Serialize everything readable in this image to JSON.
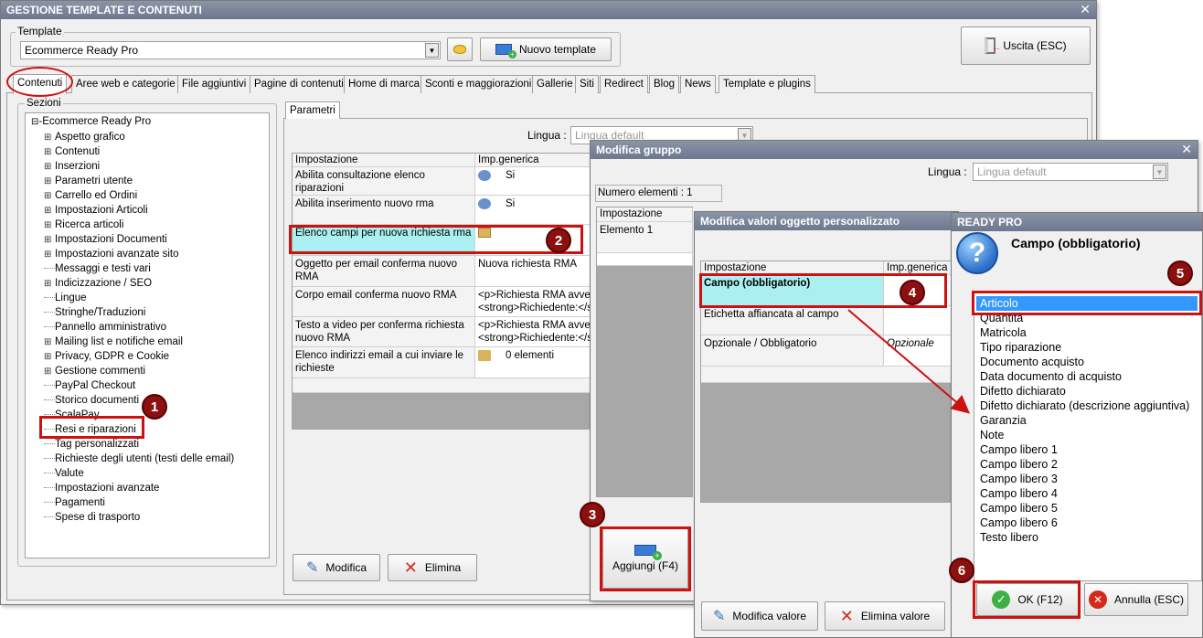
{
  "main_window": {
    "title": "GESTIONE TEMPLATE E CONTENUTI",
    "template_label": "Template",
    "template_value": "Ecommerce Ready Pro",
    "new_template_button": "Nuovo template",
    "exit_button": "Uscita (ESC)"
  },
  "tabs": [
    {
      "label": "Contenuti"
    },
    {
      "label": "Aree web e categorie"
    },
    {
      "label": "File aggiuntivi"
    },
    {
      "label": "Pagine di contenuti"
    },
    {
      "label": "Home di marca"
    },
    {
      "label": "Sconti e maggiorazioni"
    },
    {
      "label": "Gallerie"
    },
    {
      "label": "Siti"
    },
    {
      "label": "Redirect"
    },
    {
      "label": "Blog"
    },
    {
      "label": "News"
    },
    {
      "label": "Template e plugins"
    }
  ],
  "sections": {
    "label": "Sezioni",
    "root": "Ecommerce Ready Pro",
    "items": [
      {
        "label": "Aspetto grafico",
        "expandable": true
      },
      {
        "label": "Contenuti",
        "expandable": true
      },
      {
        "label": "Inserzioni",
        "expandable": true
      },
      {
        "label": "Parametri utente",
        "expandable": true
      },
      {
        "label": "Carrello ed Ordini",
        "expandable": true
      },
      {
        "label": "Impostazioni Articoli",
        "expandable": true
      },
      {
        "label": "Ricerca articoli",
        "expandable": true
      },
      {
        "label": "Impostazioni Documenti",
        "expandable": true
      },
      {
        "label": "Impostazioni avanzate sito",
        "expandable": true
      },
      {
        "label": "Messaggi e testi vari",
        "expandable": false
      },
      {
        "label": "Indicizzazione / SEO",
        "expandable": true
      },
      {
        "label": "Lingue",
        "expandable": false
      },
      {
        "label": "Stringhe/Traduzioni",
        "expandable": false
      },
      {
        "label": "Pannello amministrativo",
        "expandable": false
      },
      {
        "label": "Mailing list e notifiche email",
        "expandable": true
      },
      {
        "label": "Privacy, GDPR e Cookie",
        "expandable": true
      },
      {
        "label": "Gestione commenti",
        "expandable": true
      },
      {
        "label": "PayPal Checkout",
        "expandable": false
      },
      {
        "label": "Storico documenti",
        "expandable": false
      },
      {
        "label": "ScalaPay",
        "expandable": false
      },
      {
        "label": "Resi e riparazioni",
        "expandable": false
      },
      {
        "label": "Tag personalizzati",
        "expandable": false
      },
      {
        "label": "Richieste degli utenti (testi delle email)",
        "expandable": false
      },
      {
        "label": "Valute",
        "expandable": false
      },
      {
        "label": "Impostazioni avanzate",
        "expandable": false
      },
      {
        "label": "Pagamenti",
        "expandable": false
      },
      {
        "label": "Spese di trasporto",
        "expandable": false
      }
    ]
  },
  "params": {
    "tab": "Parametri",
    "language_label": "Lingua :",
    "language_value": "Lingua default",
    "col_setting": "Impostazione",
    "col_value": "Imp.generica",
    "rows": [
      {
        "setting": "Abilita consultazione elenco riparazioni",
        "value": "Si"
      },
      {
        "setting": "Abilita inserimento nuovo rma",
        "value": "Si"
      },
      {
        "setting": "Elenco campi per nuova richiesta rma",
        "value": ""
      },
      {
        "setting": "Oggetto per email conferma nuovo RMA",
        "value": "Nuova richiesta RMA"
      },
      {
        "setting": "Corpo email conferma nuovo RMA",
        "value": "<p>Richiesta RMA avven\n<strong>Richiedente:</s"
      },
      {
        "setting": "Testo a video per conferma richiesta nuovo RMA",
        "value": "<p>Richiesta RMA avven\n<strong>Richiedente:</s"
      },
      {
        "setting": "Elenco indirizzi email a cui inviare le richieste",
        "value": "0 elementi"
      }
    ],
    "edit_button": "Modifica",
    "delete_button": "Elimina"
  },
  "group_dialog": {
    "title": "Modifica gruppo",
    "language_label": "Lingua :",
    "language_value": "Lingua default",
    "count_label": "Numero elementi : 1",
    "col_setting": "Impostazione",
    "element": "Elemento 1",
    "add_button": "Aggiungi (F4)"
  },
  "object_dialog": {
    "title": "Modifica valori oggetto personalizzato",
    "col_setting": "Impostazione",
    "col_value": "Imp.generica",
    "rows": [
      {
        "setting": "Campo (obbligatorio)",
        "value": ""
      },
      {
        "setting": "Etichetta affiancata al campo",
        "value": ""
      },
      {
        "setting": "Opzionale / Obbligatorio",
        "value": "Opzionale"
      }
    ],
    "edit_value_button": "Modifica valore",
    "delete_value_button": "Elimina valore"
  },
  "picker_dialog": {
    "title": "READY PRO",
    "heading": "Campo (obbligatorio)",
    "options": [
      "Articolo",
      "Quantità",
      "Matricola",
      "Tipo riparazione",
      "Documento acquisto",
      "Data documento di acquisto",
      "Difetto dichiarato",
      "Difetto dichiarato (descrizione aggiuntiva)",
      "Garanzia",
      "Note",
      "Campo libero 1",
      "Campo libero 2",
      "Campo libero 3",
      "Campo libero 4",
      "Campo libero 5",
      "Campo libero 6",
      "Testo libero"
    ],
    "selected": "Articolo",
    "ok_button": "OK (F12)",
    "cancel_button": "Annulla (ESC)"
  },
  "markers": [
    "1",
    "2",
    "3",
    "4",
    "5",
    "6"
  ],
  "colors": {
    "titlebar": "#7b869b",
    "highlight_row": "#aaf0f0",
    "annotation_red": "#cc1111",
    "marker_fill": "#8b1010",
    "selection_blue": "#3399ff"
  }
}
